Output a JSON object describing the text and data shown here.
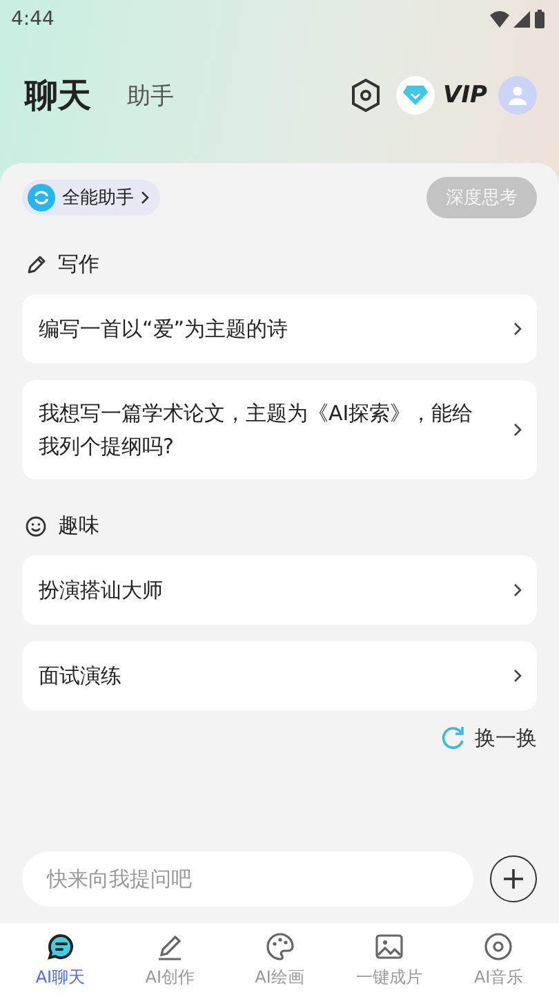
{
  "status_bar": {
    "time": "4:44"
  },
  "header": {
    "tabs": [
      {
        "label": "聊天",
        "selected": true
      },
      {
        "label": "助手",
        "selected": false
      }
    ],
    "vip": "VIP"
  },
  "assistant_chip": {
    "label": "全能助手"
  },
  "deep_think": {
    "label": "深度思考",
    "on": false
  },
  "sections": [
    {
      "kind": "pencil",
      "title": "写作",
      "prompts": [
        "编写一首以“爱”为主题的诗",
        "我想写一篇学术论文，主题为《AI探索》，能给我列个提纲吗?"
      ]
    },
    {
      "kind": "smile",
      "title": "趣味",
      "prompts": [
        "扮演搭讪大师",
        "面试演练"
      ]
    }
  ],
  "refresh": {
    "label": "换一换"
  },
  "input": {
    "placeholder": "快来向我提问吧"
  },
  "bottom_nav": [
    {
      "kind": "chat",
      "label": "AI聊天",
      "selected": true
    },
    {
      "kind": "pen",
      "label": "AI创作",
      "selected": false
    },
    {
      "kind": "palette",
      "label": "AI绘画",
      "selected": false
    },
    {
      "kind": "image",
      "label": "一键成片",
      "selected": false
    },
    {
      "kind": "disc",
      "label": "AI音乐",
      "selected": false
    }
  ]
}
